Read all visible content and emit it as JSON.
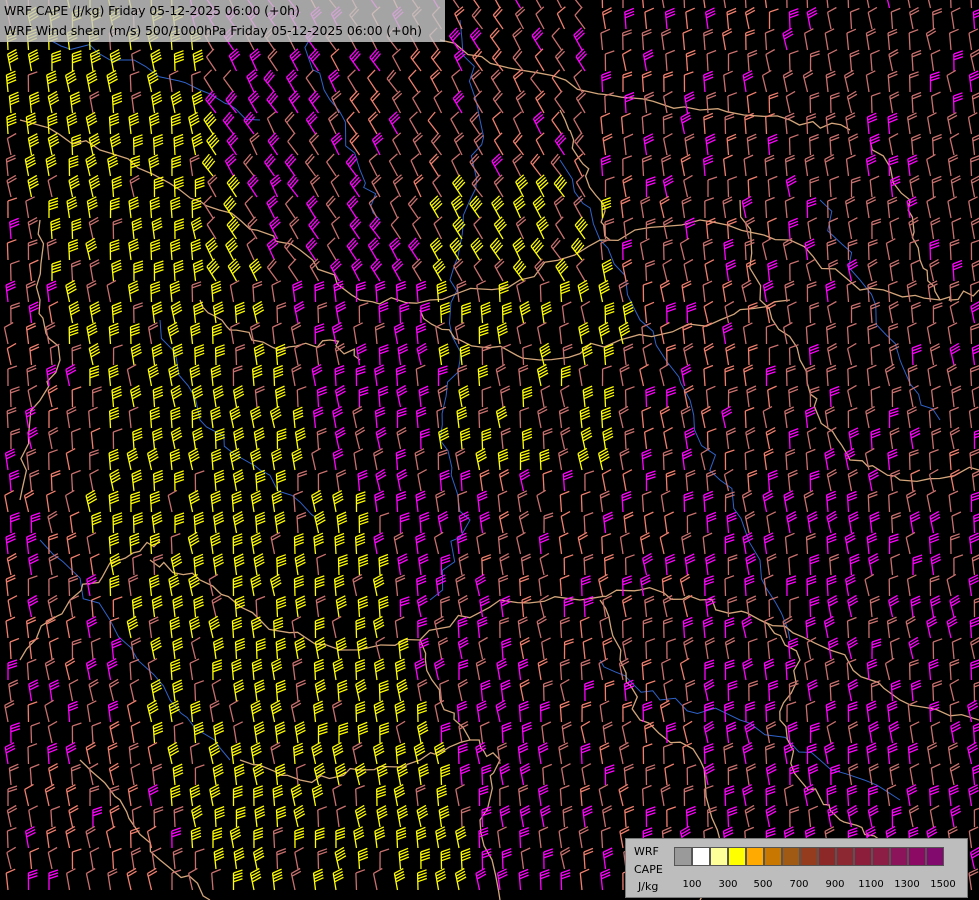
{
  "header": {
    "line1": "WRF CAPE (J/kg) Friday 05-12-2025 06:00 (+0h)",
    "line2": "WRF Wind shear (m/s) 500/1000hPa Friday 05-12-2025 06:00 (+0h)"
  },
  "legend": {
    "label_line1": "WRF",
    "label_line2": "CAPE",
    "label_unit": "J/kg",
    "ticks": [
      "100",
      "300",
      "500",
      "700",
      "900",
      "1100",
      "1300",
      "1500"
    ],
    "swatch_colors": [
      "#9a9a9a",
      "#ffffff",
      "#ffff99",
      "#ffff00",
      "#ffaa00",
      "#c87800",
      "#a05a14",
      "#963c1e",
      "#8c2828",
      "#8c2832",
      "#8c1e3c",
      "#8c1e46",
      "#8c145a",
      "#8c0a64",
      "#820a6e"
    ]
  },
  "colors": {
    "background": "#000000",
    "barb_yellow": "#ffff00",
    "barb_magenta": "#ff00ff",
    "barb_salmon": "#f07f6e",
    "barb_rose": "#c8706e",
    "border": "#d2a57a",
    "river": "#2f62c8"
  },
  "icons": {
    "barb": "wind-barb-icon"
  }
}
